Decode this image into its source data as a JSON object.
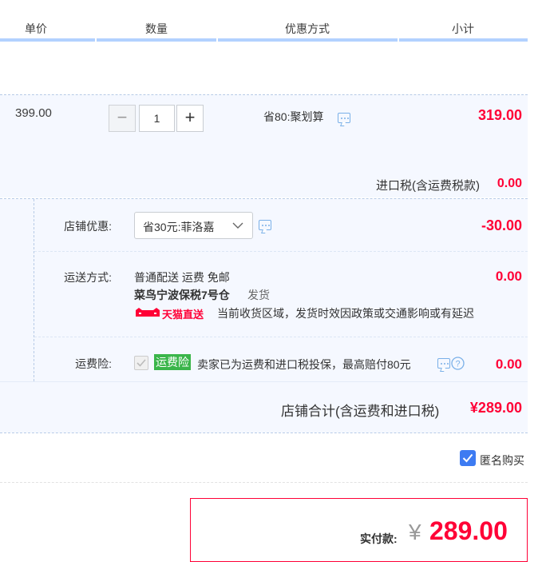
{
  "header": {
    "unit_price": "单价",
    "quantity": "数量",
    "discount": "优惠方式",
    "subtotal": "小计"
  },
  "item": {
    "unit_price": "399.00",
    "quantity": "1",
    "qty_minus": "−",
    "qty_plus": "+",
    "promotion": "省80:聚划算",
    "subtotal": "319.00",
    "import_tax_label": "进口税(含运费税款)",
    "import_tax_value": "0.00"
  },
  "shop": {
    "coupon_label": "店铺优惠:",
    "coupon_selected": "省30元:菲洛嘉",
    "coupon_value": "-30.00",
    "shipping_label": "运送方式:",
    "shipping_method": "普通配送 运费 免邮",
    "warehouse": "菜鸟宁波保税7号仓",
    "dispatch": "发货",
    "tmall_direct": "天猫直送",
    "shipping_notice": "当前收货区域，发货时效因政策或交通影响或有延迟",
    "shipping_value": "0.00",
    "insurance_label": "运费险:",
    "insurance_badge": "运费险",
    "insurance_text": "卖家已为运费和进口税投保，最高赔付80元",
    "insurance_value": "0.00",
    "total_label": "店铺合计(含运费和进口税)",
    "total_value": "¥289.00"
  },
  "anonymous": {
    "label": "匿名购买",
    "checked": true
  },
  "payment": {
    "label": "实付款:",
    "currency": "¥",
    "amount": "289.00"
  },
  "colors": {
    "price_red": "#ff0036",
    "accent_blue": "#b2d1ff",
    "checkbox_blue": "#3d7bf2",
    "insurance_green": "#3ab54a"
  }
}
